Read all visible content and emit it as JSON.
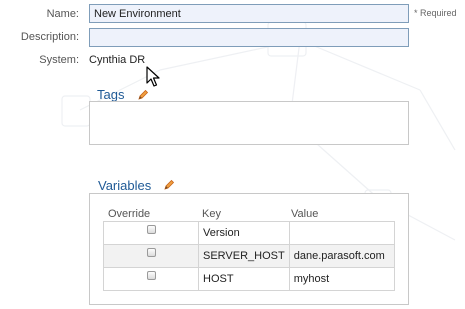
{
  "form": {
    "name_label": "Name:",
    "name_value": "New Environment",
    "required_note": "* Required",
    "description_label": "Description:",
    "description_value": "",
    "system_label": "System:",
    "system_value": "Cynthia DR"
  },
  "tags": {
    "title": "Tags",
    "edit_icon": "pencil-icon"
  },
  "variables": {
    "title": "Variables",
    "edit_icon": "pencil-icon",
    "columns": {
      "override": "Override",
      "key": "Key",
      "value": "Value"
    },
    "rows": [
      {
        "override": false,
        "key": "Version",
        "value": ""
      },
      {
        "override": false,
        "key": "SERVER_HOST",
        "value": "dane.parasoft.com"
      },
      {
        "override": false,
        "key": "HOST",
        "value": "myhost"
      }
    ]
  },
  "colors": {
    "accent": "#1f5a96",
    "input_bg": "#eef2fb",
    "input_border": "#7f9db9",
    "pencil": "#e07b20"
  }
}
